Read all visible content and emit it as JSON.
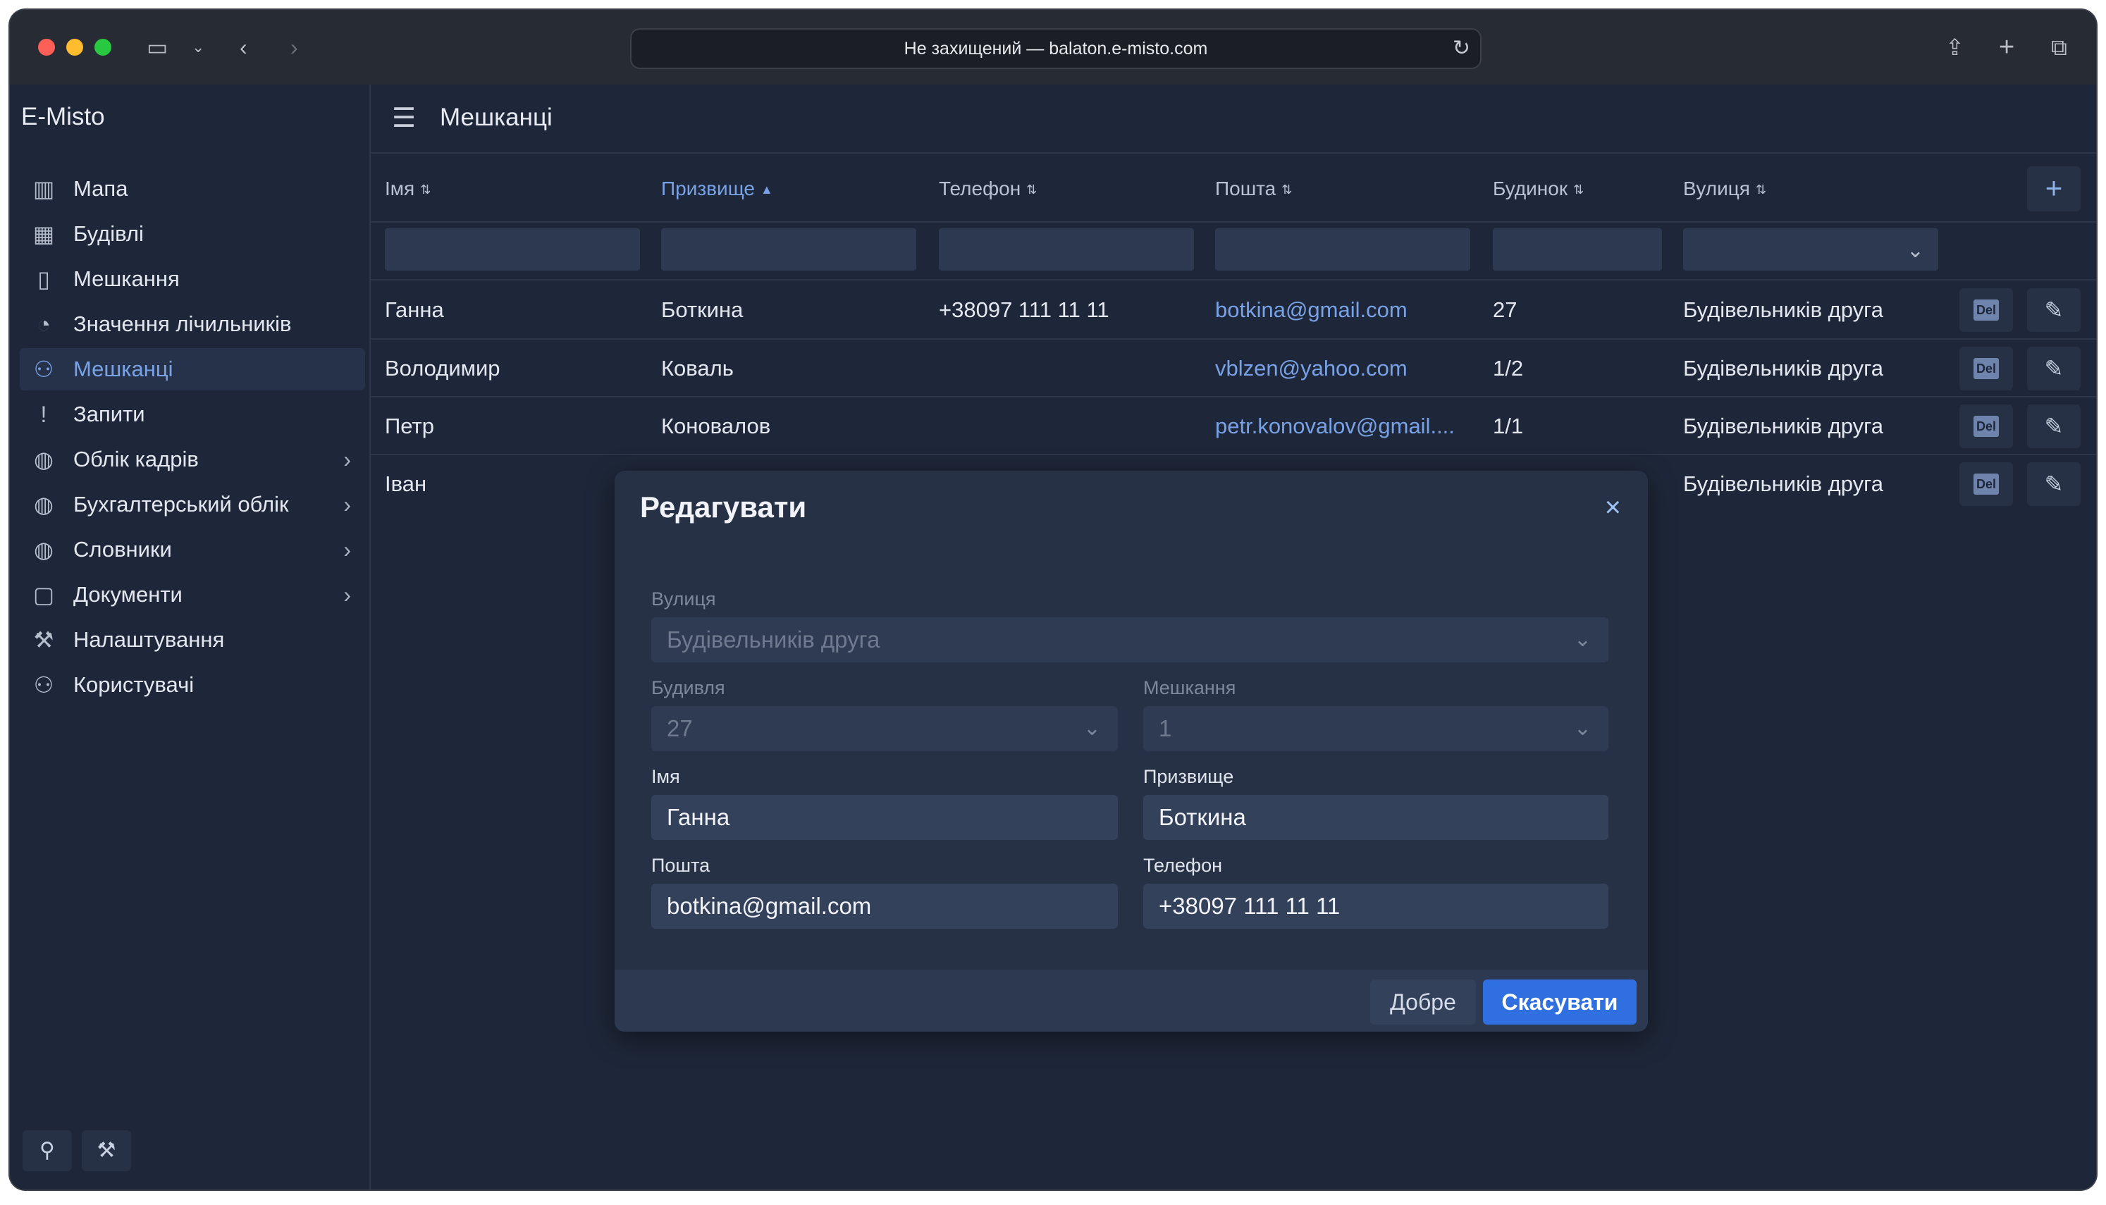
{
  "browser": {
    "address": "Не захищений — balaton.e-misto.com"
  },
  "sidebar": {
    "brand": "E-Misto",
    "items": [
      {
        "label": "Мапа",
        "icon": "map-icon"
      },
      {
        "label": "Будівлі",
        "icon": "building-icon"
      },
      {
        "label": "Мешкання",
        "icon": "door-icon"
      },
      {
        "label": "Значення лічильників",
        "icon": "gauge-icon"
      },
      {
        "label": "Мешканці",
        "icon": "users-icon",
        "active": true
      },
      {
        "label": "Запити",
        "icon": "exclamation-icon"
      },
      {
        "label": "Облік кадрів",
        "icon": "globe-icon",
        "has_children": true
      },
      {
        "label": "Бухгалтерський облік",
        "icon": "globe-icon",
        "has_children": true
      },
      {
        "label": "Словники",
        "icon": "globe-icon",
        "has_children": true
      },
      {
        "label": "Документи",
        "icon": "document-icon",
        "has_children": true
      },
      {
        "label": "Налаштування",
        "icon": "wrench-icon"
      },
      {
        "label": "Користувачі",
        "icon": "users-icon"
      }
    ]
  },
  "main": {
    "title": "Мешканці",
    "columns": [
      "Імя",
      "Призвище",
      "Телефон",
      "Пошта",
      "Будинок",
      "Вулиця"
    ],
    "sorted_column": "Призвище",
    "add_label": "+",
    "delete_label": "Del",
    "rows": [
      {
        "first": "Ганна",
        "last": "Боткина",
        "phone": "+38097 111 11 11",
        "email": "botkina@gmail.com",
        "house": "27",
        "street": "Будівельників друга"
      },
      {
        "first": "Володимир",
        "last": "Коваль",
        "phone": "",
        "email": "vblzen@yahoo.com",
        "house": "1/2",
        "street": "Будівельників друга"
      },
      {
        "first": "Петр",
        "last": "Коновалов",
        "phone": "",
        "email": "petr.konovalov@gmail....",
        "house": "1/1",
        "street": "Будівельників друга"
      },
      {
        "first": "Іван",
        "last": "",
        "phone": "",
        "email": "",
        "house": "",
        "street": "Будівельників друга"
      }
    ]
  },
  "modal": {
    "title": "Редагувати",
    "close": "×",
    "street_label": "Вулиця",
    "street_value": "Будівельників друга",
    "building_label": "Будивля",
    "building_value": "27",
    "apartment_label": "Мешкання",
    "apartment_value": "1",
    "first_label": "Імя",
    "first_value": "Ганна",
    "last_label": "Призвище",
    "last_value": "Боткина",
    "email_label": "Пошта",
    "email_value": "botkina@gmail.com",
    "phone_label": "Телефон",
    "phone_value": "+38097 111 11 11",
    "ok_label": "Добре",
    "cancel_label": "Скасувати"
  },
  "colors": {
    "background": "#1e2739",
    "accent": "#79a2e6",
    "primary_button": "#2f6fe0"
  }
}
